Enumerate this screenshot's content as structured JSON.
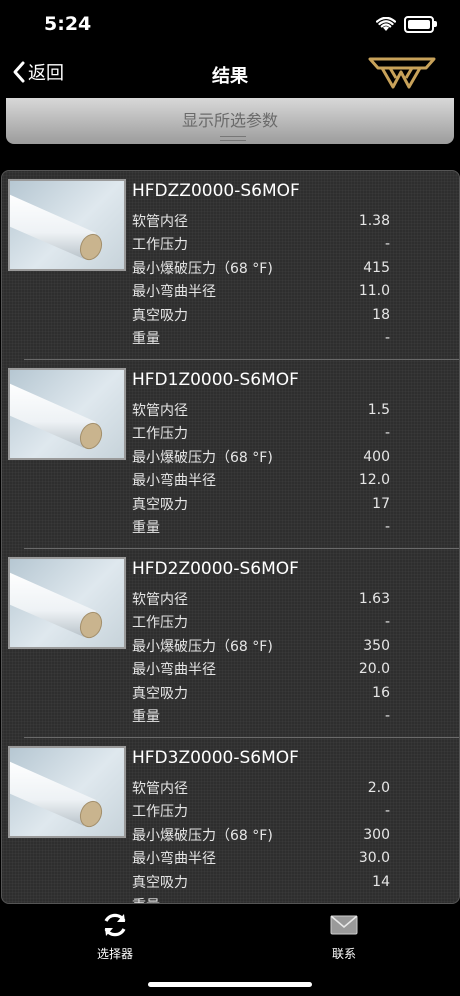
{
  "status": {
    "time": "5:24"
  },
  "nav": {
    "back_label": "返回",
    "title": "结果"
  },
  "params_bar": {
    "label": "显示所选参数"
  },
  "items": [
    {
      "name": "HFDZZ0000-S6MOF",
      "specs": [
        {
          "label": "软管内径",
          "value": "1.38"
        },
        {
          "label": "工作压力",
          "value": "-"
        },
        {
          "label": "最小爆破压力（68 °F)",
          "value": "415"
        },
        {
          "label": "最小弯曲半径",
          "value": "11.0"
        },
        {
          "label": "真空吸力",
          "value": "18"
        },
        {
          "label": "重量",
          "value": "-"
        }
      ]
    },
    {
      "name": "HFD1Z0000-S6MOF",
      "specs": [
        {
          "label": "软管内径",
          "value": "1.5"
        },
        {
          "label": "工作压力",
          "value": "-"
        },
        {
          "label": "最小爆破压力（68 °F)",
          "value": "400"
        },
        {
          "label": "最小弯曲半径",
          "value": "12.0"
        },
        {
          "label": "真空吸力",
          "value": "17"
        },
        {
          "label": "重量",
          "value": "-"
        }
      ]
    },
    {
      "name": "HFD2Z0000-S6MOF",
      "specs": [
        {
          "label": "软管内径",
          "value": "1.63"
        },
        {
          "label": "工作压力",
          "value": "-"
        },
        {
          "label": "最小爆破压力（68 °F)",
          "value": "350"
        },
        {
          "label": "最小弯曲半径",
          "value": "20.0"
        },
        {
          "label": "真空吸力",
          "value": "16"
        },
        {
          "label": "重量",
          "value": "-"
        }
      ]
    },
    {
      "name": "HFD3Z0000-S6MOF",
      "specs": [
        {
          "label": "软管内径",
          "value": "2.0"
        },
        {
          "label": "工作压力",
          "value": "-"
        },
        {
          "label": "最小爆破压力（68 °F)",
          "value": "300"
        },
        {
          "label": "最小弯曲半径",
          "value": "30.0"
        },
        {
          "label": "真空吸力",
          "value": "14"
        },
        {
          "label": "重量",
          "value": "-"
        }
      ]
    }
  ],
  "tabs": [
    {
      "label": "选择器",
      "icon": "refresh-icon"
    },
    {
      "label": "联系",
      "icon": "mail-icon"
    }
  ],
  "colors": {
    "background": "#000000",
    "list_bg": "#2e2e2e",
    "accent_logo": "#c8a25a"
  }
}
